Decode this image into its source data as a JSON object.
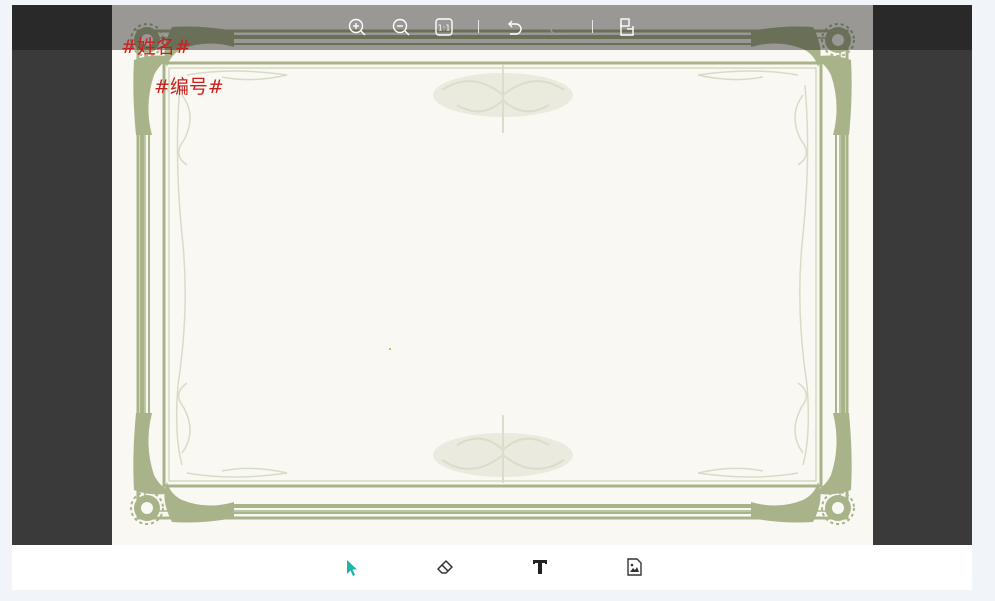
{
  "colors": {
    "workspace_bg": "#3a3a3a",
    "paper": "#faf8f2",
    "frame_green": "#a9b38a",
    "frame_light": "#d7dcc6",
    "field_text": "#c8201f",
    "active_tool": "#1bb6a8"
  },
  "top_toolbar": {
    "buttons": [
      {
        "name": "zoom-in",
        "icon": "zoom-in-icon"
      },
      {
        "name": "zoom-out",
        "icon": "zoom-out-icon"
      },
      {
        "name": "actual-size",
        "icon": "actual-size-icon",
        "label": "1:1"
      },
      {
        "name": "undo",
        "icon": "undo-icon"
      },
      {
        "name": "redo",
        "icon": "redo-icon",
        "disabled": true
      },
      {
        "name": "export",
        "icon": "export-icon"
      }
    ]
  },
  "fields": {
    "name": "#姓名#",
    "number": "#编号#"
  },
  "bottom_toolbar": {
    "active_tool": "select",
    "tools": [
      {
        "name": "select",
        "icon": "cursor-icon"
      },
      {
        "name": "eraser",
        "icon": "eraser-icon"
      },
      {
        "name": "text",
        "icon": "text-icon"
      },
      {
        "name": "image",
        "icon": "image-icon"
      }
    ]
  }
}
